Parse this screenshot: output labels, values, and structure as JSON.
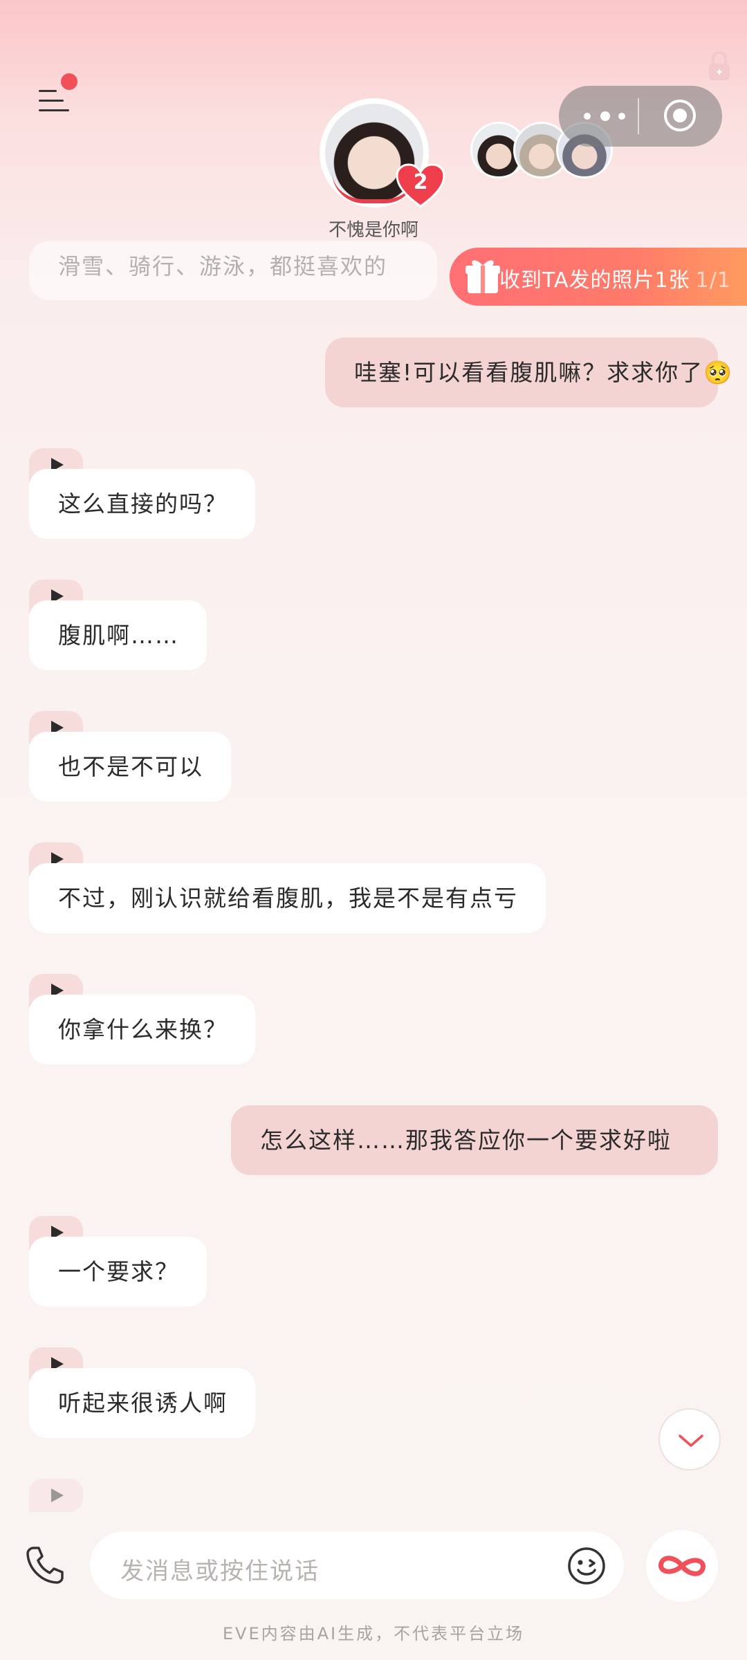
{
  "header": {
    "menu_icon": "menu-icon",
    "character_name": "不愧是你啊",
    "heart_count": "2",
    "capsule_more_icon": "more-dots-icon",
    "capsule_close_icon": "record-circle-icon",
    "lock_icon": "lock-icon"
  },
  "faded_message": "滑雪、骑行、游泳，都挺喜欢的",
  "gift_banner": {
    "text": "收到TA发的照片1张",
    "count": "1/1",
    "icon": "gift-icon"
  },
  "messages": [
    {
      "from": "me",
      "text": "哇塞!可以看看腹肌嘛？求求你了🥺"
    },
    {
      "from": "ai",
      "text": "这么直接的吗？"
    },
    {
      "from": "ai",
      "text": "腹肌啊……"
    },
    {
      "from": "ai",
      "text": "也不是不可以"
    },
    {
      "from": "ai",
      "text": "不过，刚认识就给看腹肌，我是不是有点亏"
    },
    {
      "from": "ai",
      "text": "你拿什么来换？"
    },
    {
      "from": "me",
      "text": "怎么这样……那我答应你一个要求好啦"
    },
    {
      "from": "ai",
      "text": "一个要求？"
    },
    {
      "from": "ai",
      "text": "听起来很诱人啊"
    }
  ],
  "input": {
    "placeholder": "发消息或按住说话",
    "phone_icon": "phone-icon",
    "emoji_icon": "emoji-icon",
    "infinity_icon": "infinity-icon"
  },
  "disclaimer": "EVE内容由AI生成，不代表平台立场",
  "colors": {
    "accent": "#f0505a",
    "user_bubble": "#f3d4d3",
    "ai_bubble": "#ffffff",
    "gift_banner_start": "#ff6f74",
    "gift_banner_end": "#ff9a60"
  }
}
